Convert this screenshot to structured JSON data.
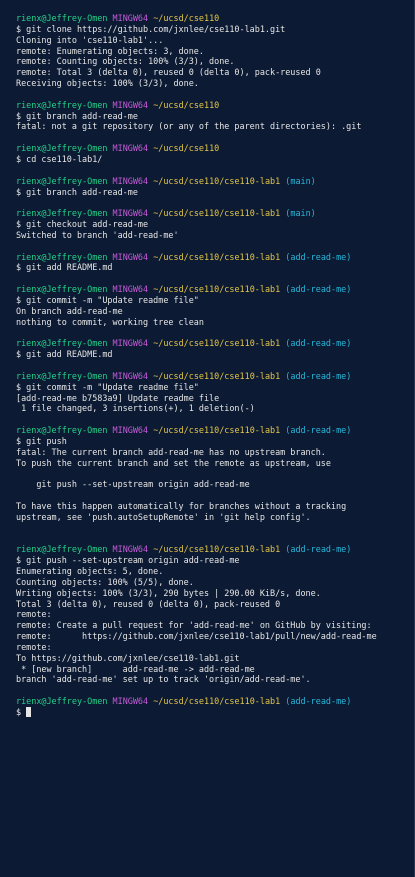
{
  "colors": {
    "background": "#0c1a33",
    "user": "#24d38a",
    "host": "#c55bd9",
    "path": "#e3c64a",
    "branch": "#29b8db",
    "text": "#e6e6e6"
  },
  "lines": [
    {
      "kind": "prompt",
      "user": "rienx@Jeffrey-Omen",
      "host": "MINGW64",
      "path": "~/ucsd/cse110",
      "branch": ""
    },
    {
      "kind": "cmd",
      "text": "$ git clone https://github.com/jxnlee/cse110-lab1.git"
    },
    {
      "kind": "out",
      "text": "Cloning into 'cse110-lab1'..."
    },
    {
      "kind": "out",
      "text": "remote: Enumerating objects: 3, done."
    },
    {
      "kind": "out",
      "text": "remote: Counting objects: 100% (3/3), done."
    },
    {
      "kind": "out",
      "text": "remote: Total 3 (delta 0), reused 0 (delta 0), pack-reused 0"
    },
    {
      "kind": "out",
      "text": "Receiving objects: 100% (3/3), done."
    },
    {
      "kind": "blank"
    },
    {
      "kind": "prompt",
      "user": "rienx@Jeffrey-Omen",
      "host": "MINGW64",
      "path": "~/ucsd/cse110",
      "branch": ""
    },
    {
      "kind": "cmd",
      "text": "$ git branch add-read-me"
    },
    {
      "kind": "out",
      "text": "fatal: not a git repository (or any of the parent directories): .git"
    },
    {
      "kind": "blank"
    },
    {
      "kind": "prompt",
      "user": "rienx@Jeffrey-Omen",
      "host": "MINGW64",
      "path": "~/ucsd/cse110",
      "branch": ""
    },
    {
      "kind": "cmd",
      "text": "$ cd cse110-lab1/"
    },
    {
      "kind": "blank"
    },
    {
      "kind": "prompt",
      "user": "rienx@Jeffrey-Omen",
      "host": "MINGW64",
      "path": "~/ucsd/cse110/cse110-lab1",
      "branch": "(main)"
    },
    {
      "kind": "cmd",
      "text": "$ git branch add-read-me"
    },
    {
      "kind": "blank"
    },
    {
      "kind": "prompt",
      "user": "rienx@Jeffrey-Omen",
      "host": "MINGW64",
      "path": "~/ucsd/cse110/cse110-lab1",
      "branch": "(main)"
    },
    {
      "kind": "cmd",
      "text": "$ git checkout add-read-me"
    },
    {
      "kind": "out",
      "text": "Switched to branch 'add-read-me'"
    },
    {
      "kind": "blank"
    },
    {
      "kind": "prompt",
      "user": "rienx@Jeffrey-Omen",
      "host": "MINGW64",
      "path": "~/ucsd/cse110/cse110-lab1",
      "branch": "(add-read-me)"
    },
    {
      "kind": "cmd",
      "text": "$ git add README.md"
    },
    {
      "kind": "blank"
    },
    {
      "kind": "prompt",
      "user": "rienx@Jeffrey-Omen",
      "host": "MINGW64",
      "path": "~/ucsd/cse110/cse110-lab1",
      "branch": "(add-read-me)"
    },
    {
      "kind": "cmd",
      "text": "$ git commit -m \"Update readme file\""
    },
    {
      "kind": "out",
      "text": "On branch add-read-me"
    },
    {
      "kind": "out",
      "text": "nothing to commit, working tree clean"
    },
    {
      "kind": "blank"
    },
    {
      "kind": "prompt",
      "user": "rienx@Jeffrey-Omen",
      "host": "MINGW64",
      "path": "~/ucsd/cse110/cse110-lab1",
      "branch": "(add-read-me)"
    },
    {
      "kind": "cmd",
      "text": "$ git add README.md"
    },
    {
      "kind": "blank"
    },
    {
      "kind": "prompt",
      "user": "rienx@Jeffrey-Omen",
      "host": "MINGW64",
      "path": "~/ucsd/cse110/cse110-lab1",
      "branch": "(add-read-me)"
    },
    {
      "kind": "cmd",
      "text": "$ git commit -m \"Update readme file\""
    },
    {
      "kind": "out",
      "text": "[add-read-me b7583a9] Update readme file"
    },
    {
      "kind": "out",
      "text": " 1 file changed, 3 insertions(+), 1 deletion(-)"
    },
    {
      "kind": "blank"
    },
    {
      "kind": "prompt",
      "user": "rienx@Jeffrey-Omen",
      "host": "MINGW64",
      "path": "~/ucsd/cse110/cse110-lab1",
      "branch": "(add-read-me)"
    },
    {
      "kind": "cmd",
      "text": "$ git push"
    },
    {
      "kind": "out",
      "text": "fatal: The current branch add-read-me has no upstream branch."
    },
    {
      "kind": "out",
      "text": "To push the current branch and set the remote as upstream, use"
    },
    {
      "kind": "blank"
    },
    {
      "kind": "out",
      "text": "    git push --set-upstream origin add-read-me"
    },
    {
      "kind": "blank"
    },
    {
      "kind": "out",
      "text": "To have this happen automatically for branches without a tracking"
    },
    {
      "kind": "out",
      "text": "upstream, see 'push.autoSetupRemote' in 'git help config'."
    },
    {
      "kind": "blank"
    },
    {
      "kind": "blank"
    },
    {
      "kind": "prompt",
      "user": "rienx@Jeffrey-Omen",
      "host": "MINGW64",
      "path": "~/ucsd/cse110/cse110-lab1",
      "branch": "(add-read-me)"
    },
    {
      "kind": "cmd",
      "text": "$ git push --set-upstream origin add-read-me"
    },
    {
      "kind": "out",
      "text": "Enumerating objects: 5, done."
    },
    {
      "kind": "out",
      "text": "Counting objects: 100% (5/5), done."
    },
    {
      "kind": "out",
      "text": "Writing objects: 100% (3/3), 290 bytes | 290.00 KiB/s, done."
    },
    {
      "kind": "out",
      "text": "Total 3 (delta 0), reused 0 (delta 0), pack-reused 0"
    },
    {
      "kind": "out",
      "text": "remote:"
    },
    {
      "kind": "out",
      "text": "remote: Create a pull request for 'add-read-me' on GitHub by visiting:"
    },
    {
      "kind": "out",
      "text": "remote:      https://github.com/jxnlee/cse110-lab1/pull/new/add-read-me"
    },
    {
      "kind": "out",
      "text": "remote:"
    },
    {
      "kind": "out",
      "text": "To https://github.com/jxnlee/cse110-lab1.git"
    },
    {
      "kind": "out",
      "text": " * [new branch]      add-read-me -> add-read-me"
    },
    {
      "kind": "out",
      "text": "branch 'add-read-me' set up to track 'origin/add-read-me'."
    },
    {
      "kind": "blank"
    },
    {
      "kind": "prompt",
      "user": "rienx@Jeffrey-Omen",
      "host": "MINGW64",
      "path": "~/ucsd/cse110/cse110-lab1",
      "branch": "(add-read-me)"
    },
    {
      "kind": "input",
      "text": "$ "
    }
  ]
}
